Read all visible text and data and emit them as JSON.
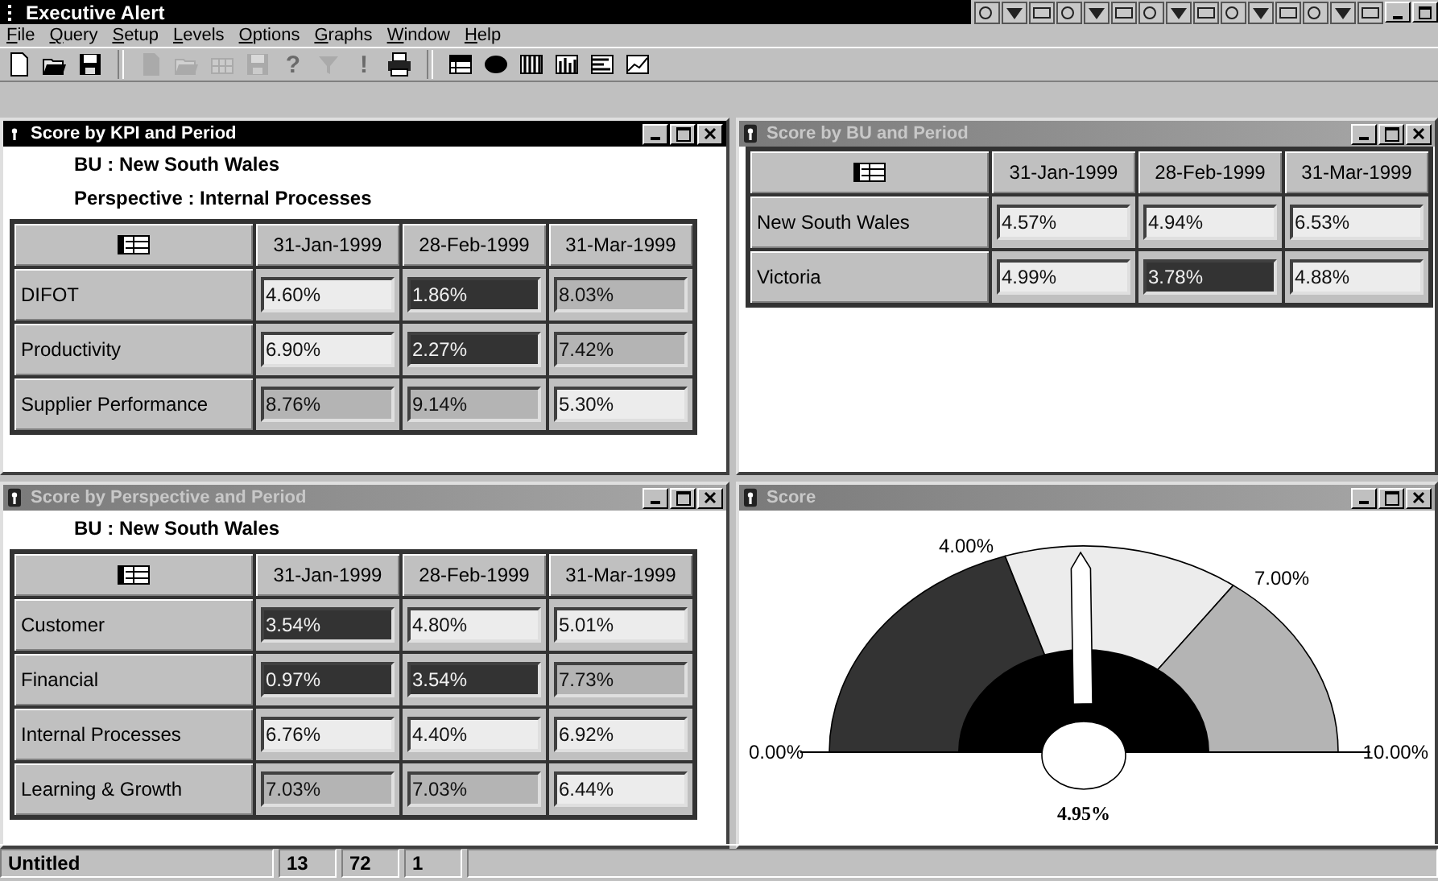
{
  "window": {
    "title": "Executive Alert"
  },
  "menu": [
    {
      "label": "File"
    },
    {
      "label": "Query"
    },
    {
      "label": "Setup"
    },
    {
      "label": "Levels"
    },
    {
      "label": "Options"
    },
    {
      "label": "Graphs"
    },
    {
      "label": "Window"
    },
    {
      "label": "Help"
    }
  ],
  "toolbar": [
    {
      "kind": "new",
      "disabled": false
    },
    {
      "kind": "open",
      "disabled": false
    },
    {
      "kind": "save",
      "disabled": false
    },
    {
      "kind": "separator"
    },
    {
      "kind": "doc",
      "disabled": true
    },
    {
      "kind": "folder",
      "disabled": true
    },
    {
      "kind": "grid",
      "disabled": true
    },
    {
      "kind": "save",
      "disabled": true
    },
    {
      "kind": "glyph",
      "glyph": "?",
      "disabled": true
    },
    {
      "kind": "filter",
      "disabled": true
    },
    {
      "kind": "glyph",
      "glyph": "!",
      "disabled": true
    },
    {
      "kind": "print",
      "disabled": false
    },
    {
      "kind": "separator"
    },
    {
      "kind": "table",
      "disabled": false
    },
    {
      "kind": "oval",
      "disabled": false
    },
    {
      "kind": "bars",
      "disabled": false
    },
    {
      "kind": "columns",
      "disabled": false
    },
    {
      "kind": "hbars",
      "disabled": false
    },
    {
      "kind": "line",
      "disabled": false
    }
  ],
  "windows": [
    {
      "title": "Score by KPI and Period",
      "active": true,
      "kind": "table",
      "filters": [
        "BU : New South Wales",
        "Perspective : Internal Processes"
      ],
      "columns": [
        "31-Jan-1999",
        "28-Feb-1999",
        "31-Mar-1999"
      ],
      "rows": [
        {
          "label": "DIFOT",
          "cells": [
            {
              "value": "4.60%",
              "kind": "mid"
            },
            {
              "value": "1.86%",
              "kind": "low"
            },
            {
              "value": "8.03%",
              "kind": "high"
            }
          ]
        },
        {
          "label": "Productivity",
          "cells": [
            {
              "value": "6.90%",
              "kind": "mid"
            },
            {
              "value": "2.27%",
              "kind": "low"
            },
            {
              "value": "7.42%",
              "kind": "high"
            }
          ]
        },
        {
          "label": "Supplier Performance",
          "cells": [
            {
              "value": "8.76%",
              "kind": "high"
            },
            {
              "value": "9.14%",
              "kind": "high"
            },
            {
              "value": "5.30%",
              "kind": "mid"
            }
          ]
        }
      ]
    },
    {
      "title": "Score by BU and Period",
      "active": false,
      "kind": "table",
      "columns": [
        "31-Jan-1999",
        "28-Feb-1999",
        "31-Mar-1999"
      ],
      "rows": [
        {
          "label": "New South Wales",
          "cells": [
            {
              "value": "4.57%",
              "kind": "mid"
            },
            {
              "value": "4.94%",
              "kind": "mid"
            },
            {
              "value": "6.53%",
              "kind": "mid"
            }
          ]
        },
        {
          "label": "Victoria",
          "cells": [
            {
              "value": "4.99%",
              "kind": "mid"
            },
            {
              "value": "3.78%",
              "kind": "low"
            },
            {
              "value": "4.88%",
              "kind": "mid"
            }
          ]
        }
      ]
    },
    {
      "title": "Score by Perspective and Period",
      "active": false,
      "kind": "table",
      "filters": [
        "BU : New South Wales"
      ],
      "columns": [
        "31-Jan-1999",
        "28-Feb-1999",
        "31-Mar-1999"
      ],
      "rows": [
        {
          "label": "Customer",
          "cells": [
            {
              "value": "3.54%",
              "kind": "low"
            },
            {
              "value": "4.80%",
              "kind": "mid"
            },
            {
              "value": "5.01%",
              "kind": "mid"
            }
          ]
        },
        {
          "label": "Financial",
          "cells": [
            {
              "value": "0.97%",
              "kind": "low"
            },
            {
              "value": "3.54%",
              "kind": "low"
            },
            {
              "value": "7.73%",
              "kind": "high"
            }
          ]
        },
        {
          "label": "Internal Processes",
          "cells": [
            {
              "value": "6.76%",
              "kind": "mid"
            },
            {
              "value": "4.40%",
              "kind": "mid"
            },
            {
              "value": "6.92%",
              "kind": "mid"
            }
          ]
        },
        {
          "label": "Learning & Growth",
          "cells": [
            {
              "value": "7.03%",
              "kind": "high"
            },
            {
              "value": "7.03%",
              "kind": "high"
            },
            {
              "value": "6.44%",
              "kind": "mid"
            }
          ]
        }
      ]
    },
    {
      "title": "Score",
      "active": false,
      "kind": "gauge",
      "scale_labels": [
        "0.00%",
        "4.00%",
        "7.00%",
        "10.00%"
      ],
      "reading": "4.95%",
      "level": 0.495
    }
  ],
  "status_bar": [
    "Untitled",
    "13",
    "72",
    "1"
  ]
}
